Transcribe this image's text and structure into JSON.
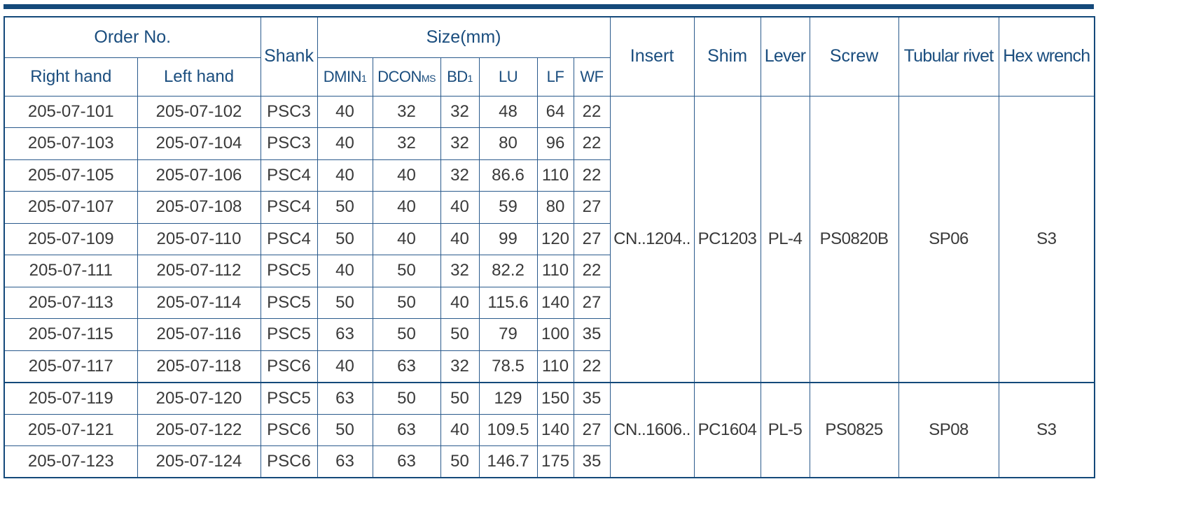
{
  "headers": {
    "order_no": "Order No.",
    "right_hand": "Right hand",
    "left_hand": "Left hand",
    "shank": "Shank",
    "size": "Size(mm)",
    "dmin": {
      "base": "DMIN",
      "sub": "1"
    },
    "dcon": {
      "base": "DCON",
      "sub": "MS"
    },
    "bd": {
      "base": "BD",
      "sub": "1"
    },
    "lu": "LU",
    "lf": "LF",
    "wf": "WF",
    "insert": "Insert",
    "shim": "Shim",
    "lever": "Lever",
    "screw": "Screw",
    "tubular_rivet": "Tubular rivet",
    "hex_wrench": "Hex wrench"
  },
  "rows": [
    {
      "right": "205-07-101",
      "left": "205-07-102",
      "shank": "PSC3",
      "dmin": "40",
      "dcon": "32",
      "bd": "32",
      "lu": "48",
      "lf": "64",
      "wf": "22"
    },
    {
      "right": "205-07-103",
      "left": "205-07-104",
      "shank": "PSC3",
      "dmin": "40",
      "dcon": "32",
      "bd": "32",
      "lu": "80",
      "lf": "96",
      "wf": "22"
    },
    {
      "right": "205-07-105",
      "left": "205-07-106",
      "shank": "PSC4",
      "dmin": "40",
      "dcon": "40",
      "bd": "32",
      "lu": "86.6",
      "lf": "110",
      "wf": "22"
    },
    {
      "right": "205-07-107",
      "left": "205-07-108",
      "shank": "PSC4",
      "dmin": "50",
      "dcon": "40",
      "bd": "40",
      "lu": "59",
      "lf": "80",
      "wf": "27"
    },
    {
      "right": "205-07-109",
      "left": "205-07-110",
      "shank": "PSC4",
      "dmin": "50",
      "dcon": "40",
      "bd": "40",
      "lu": "99",
      "lf": "120",
      "wf": "27"
    },
    {
      "right": "205-07-111",
      "left": "205-07-112",
      "shank": "PSC5",
      "dmin": "40",
      "dcon": "50",
      "bd": "32",
      "lu": "82.2",
      "lf": "110",
      "wf": "22"
    },
    {
      "right": "205-07-113",
      "left": "205-07-114",
      "shank": "PSC5",
      "dmin": "50",
      "dcon": "50",
      "bd": "40",
      "lu": "115.6",
      "lf": "140",
      "wf": "27"
    },
    {
      "right": "205-07-115",
      "left": "205-07-116",
      "shank": "PSC5",
      "dmin": "63",
      "dcon": "50",
      "bd": "50",
      "lu": "79",
      "lf": "100",
      "wf": "35"
    },
    {
      "right": "205-07-117",
      "left": "205-07-118",
      "shank": "PSC6",
      "dmin": "40",
      "dcon": "63",
      "bd": "32",
      "lu": "78.5",
      "lf": "110",
      "wf": "22"
    },
    {
      "right": "205-07-119",
      "left": "205-07-120",
      "shank": "PSC5",
      "dmin": "63",
      "dcon": "50",
      "bd": "50",
      "lu": "129",
      "lf": "150",
      "wf": "35"
    },
    {
      "right": "205-07-121",
      "left": "205-07-122",
      "shank": "PSC6",
      "dmin": "50",
      "dcon": "63",
      "bd": "40",
      "lu": "109.5",
      "lf": "140",
      "wf": "27"
    },
    {
      "right": "205-07-123",
      "left": "205-07-124",
      "shank": "PSC6",
      "dmin": "63",
      "dcon": "63",
      "bd": "50",
      "lu": "146.7",
      "lf": "175",
      "wf": "35"
    }
  ],
  "accessory_groups": [
    {
      "insert": "CN..1204..",
      "shim": "PC1203",
      "lever": "PL-4",
      "screw": "PS0820B",
      "tubular_rivet": "SP06",
      "hex_wrench": "S3"
    },
    {
      "insert": "CN..1606..",
      "shim": "PC1604",
      "lever": "PL-5",
      "screw": "PS0825",
      "tubular_rivet": "SP08",
      "hex_wrench": "S3"
    }
  ],
  "colors": {
    "accent": "#14497a",
    "header_text": "#1a4d7e",
    "body_text": "#3a3a3a"
  }
}
